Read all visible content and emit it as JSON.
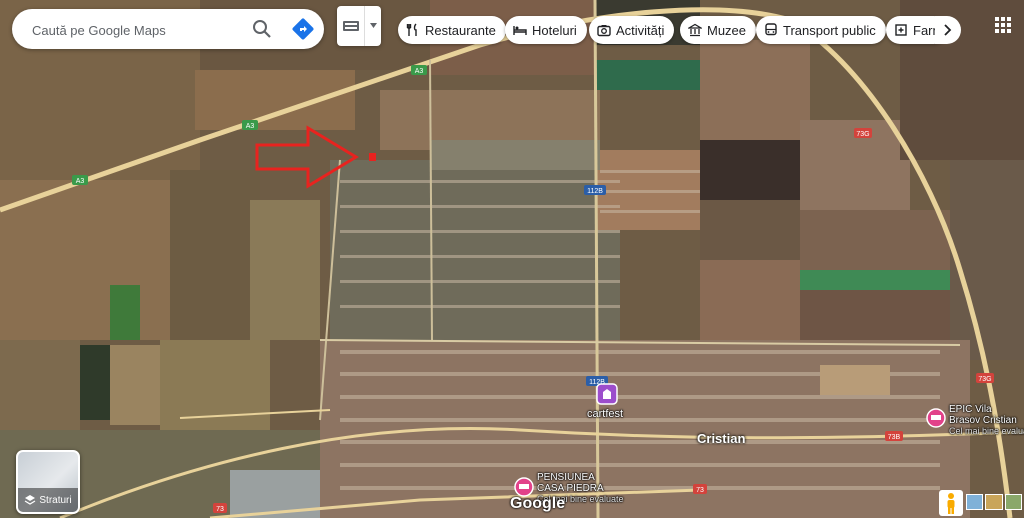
{
  "search": {
    "placeholder": "Caută pe Google Maps"
  },
  "chips": [
    {
      "label": "Restaurante",
      "icon": "fork-knife-icon"
    },
    {
      "label": "Hoteluri",
      "icon": "bed-icon"
    },
    {
      "label": "Activități",
      "icon": "camera-icon"
    },
    {
      "label": "Muzee",
      "icon": "museum-icon"
    },
    {
      "label": "Transport public",
      "icon": "bus-icon"
    },
    {
      "label": "Farm",
      "icon": "pharmacy-icon"
    }
  ],
  "roads": {
    "a3_shield": "A3",
    "r73g_shield": "73G",
    "r112b_shield": "112B",
    "r73b_shield": "73B",
    "r73_shield": "73"
  },
  "places": {
    "town": "Cristian",
    "cartfest": "cartfest",
    "epic": {
      "line1": "EPIC Vila",
      "line2": "Brasov Cristian",
      "line3": "Cel mai bine evalua"
    },
    "pensiunea": {
      "line1": "PENSIUNEA",
      "line2": "CASA PIEDRA",
      "line3": "Cel mai bine evaluate"
    }
  },
  "layers": {
    "label": "Straturi"
  },
  "brand": "Google",
  "colors": {
    "arrow": "#e8231f",
    "poi_pink": "#e2428a",
    "poi_purple": "#9c4dcc",
    "road": "#e7c98a"
  }
}
